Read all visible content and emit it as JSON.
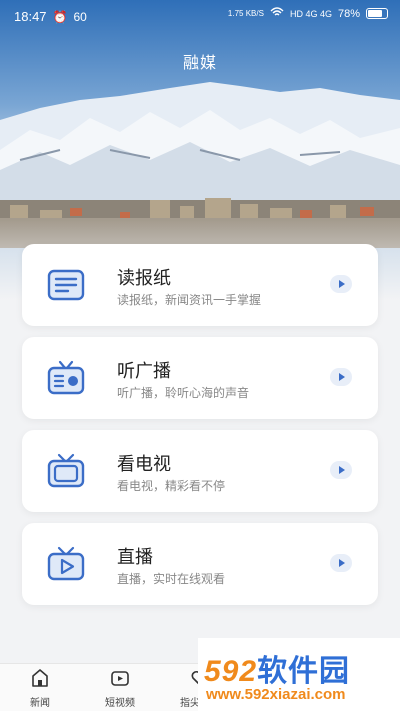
{
  "status_bar": {
    "time": "18:47",
    "fps": "60",
    "speed": "1.75 KB/S",
    "network": "HD 4G 4G",
    "battery": "78%"
  },
  "header": {
    "title": "融媒"
  },
  "cards": [
    {
      "title": "读报纸",
      "desc": "读报纸，新闻资讯一手掌握",
      "icon": "newspaper-icon"
    },
    {
      "title": "听广播",
      "desc": "听广播，聆听心海的声音",
      "icon": "radio-icon"
    },
    {
      "title": "看电视",
      "desc": "看电视，精彩看不停",
      "icon": "tv-icon"
    },
    {
      "title": "直播",
      "desc": "直播，实时在线观看",
      "icon": "live-play-icon"
    }
  ],
  "tabbar": {
    "items": [
      {
        "label": "新闻",
        "icon": "news-icon"
      },
      {
        "label": "短视频",
        "icon": "short-video-icon"
      },
      {
        "label": "指尖服务",
        "icon": "heart-service-icon"
      }
    ]
  },
  "watermark": {
    "brand_num": "592",
    "brand_text": "软件园",
    "url": "www.592xiazai.com"
  },
  "colors": {
    "accent": "#3b6dc7",
    "background": "#f2f3f5",
    "watermark_orange": "#f08a1c"
  }
}
